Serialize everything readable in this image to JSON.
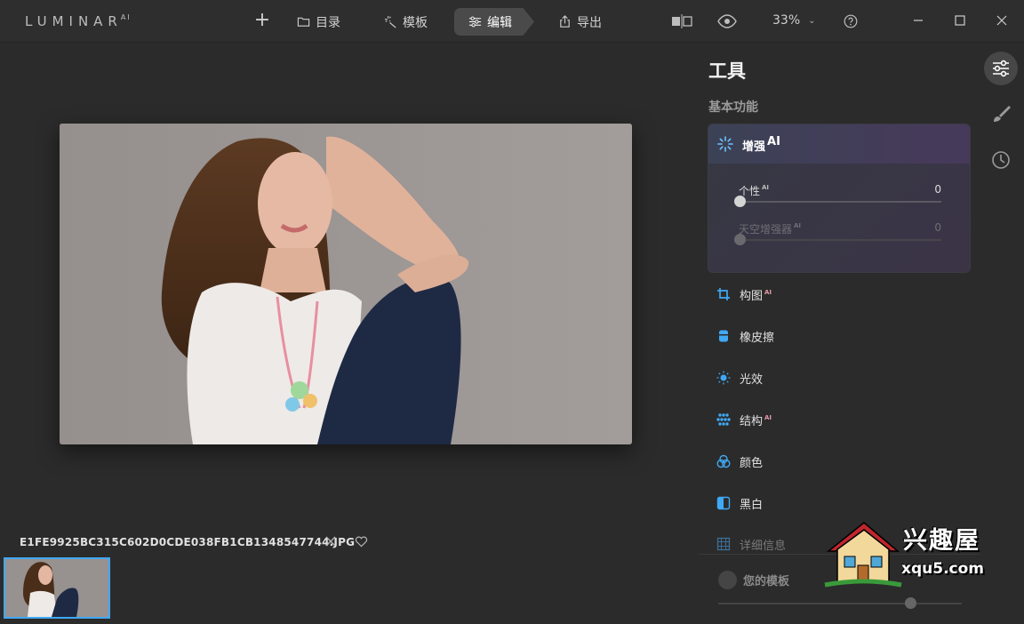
{
  "app": {
    "logo": "LUMINAR",
    "logo_suffix": "AI"
  },
  "nav": {
    "catalog": "目录",
    "templates": "模板",
    "edit": "编辑",
    "export": "导出"
  },
  "zoom": {
    "level": "33%"
  },
  "file": {
    "name": "E1FE9925BC315C602D0CDE038FB1CB1348547744.JPG"
  },
  "panel": {
    "title": "工具",
    "subtitle": "基本功能",
    "enhance": {
      "title": "增强",
      "ai": "AI",
      "sliders": [
        {
          "label": "个性",
          "ai": "AI",
          "value": "0",
          "fraction": 0
        },
        {
          "label": "天空增强器",
          "ai": "AI",
          "value": "0",
          "fraction": 0
        }
      ]
    },
    "tools": [
      {
        "label": "构图",
        "ai": "AI",
        "icon": "crop-icon"
      },
      {
        "label": "橡皮擦",
        "ai": "",
        "icon": "eraser-icon"
      },
      {
        "label": "光效",
        "ai": "",
        "icon": "sun-icon"
      },
      {
        "label": "结构",
        "ai": "AI",
        "icon": "structure-icon"
      },
      {
        "label": "颜色",
        "ai": "",
        "icon": "color-icon"
      },
      {
        "label": "黑白",
        "ai": "",
        "icon": "bw-icon"
      },
      {
        "label": "详细信息",
        "ai": "",
        "icon": "detail-icon"
      }
    ],
    "my_templates": {
      "label": "您的模板",
      "amount": 0.79
    }
  },
  "watermark": {
    "text": "兴趣屋",
    "url": "xqu5.com"
  },
  "colors": {
    "accent": "#3fa9f5",
    "ai_badge": "#e59aa9",
    "bg": "#2b2b2b"
  }
}
